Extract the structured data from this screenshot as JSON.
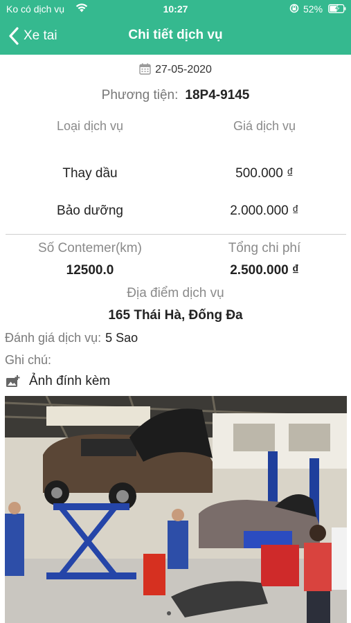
{
  "status_bar": {
    "carrier": "Ko có dịch vụ",
    "time": "10:27",
    "battery": "52%",
    "icons": [
      "wifi-icon",
      "orientation-lock-icon",
      "battery-charging-icon"
    ]
  },
  "nav": {
    "back_label": "Xe tai",
    "title": "Chi tiết dịch vụ",
    "background_color": "#35b98f"
  },
  "service": {
    "date": "27-05-2020",
    "vehicle_label": "Phương tiện:",
    "vehicle_plate": "18P4-9145",
    "table_headers": [
      "Loại dịch vụ",
      "Giá dịch vụ"
    ],
    "items": [
      {
        "type": "Thay dầu",
        "price": "500.000 ₫"
      },
      {
        "type": "Bảo dưỡng",
        "price": "2.000.000 ₫"
      }
    ],
    "odometer_label": "Số Contemer(km)",
    "odometer_value": "12500.0",
    "total_label": "Tổng chi phí",
    "total_value": "2.500.000 ₫",
    "location_label": "Địa điểm dịch vụ",
    "location_value": "165 Thái Hà, Đống Đa",
    "rating_label": "Đánh giá dịch vụ:",
    "rating_value": "5 Sao",
    "notes_label": "Ghi chú:",
    "attachments_label": "Ảnh đính kèm"
  }
}
